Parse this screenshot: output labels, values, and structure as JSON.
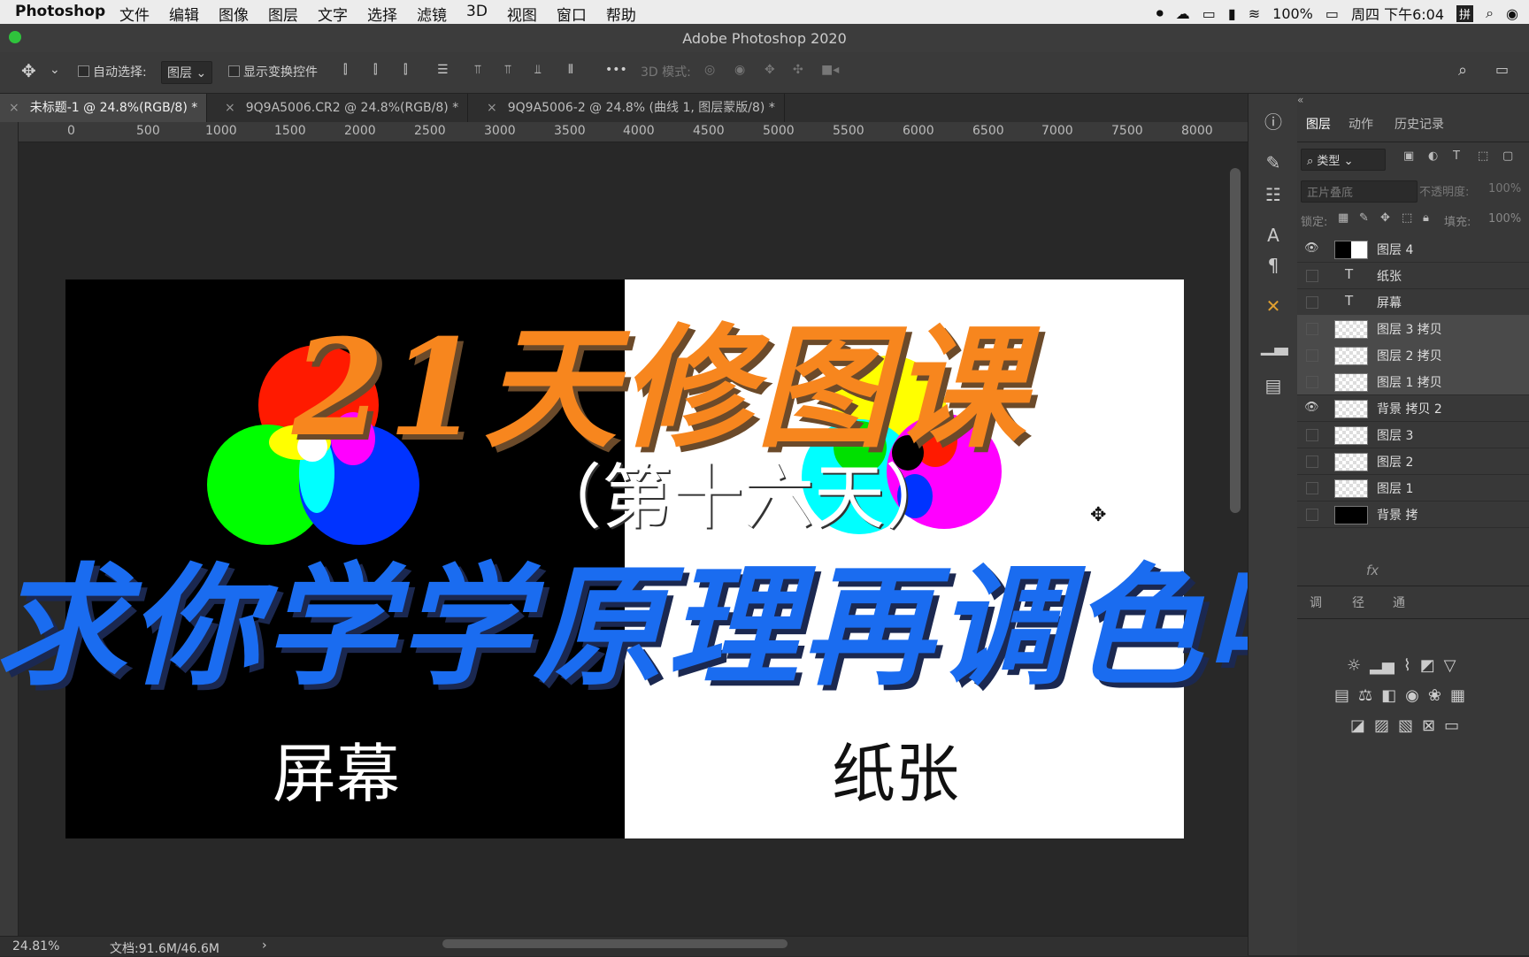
{
  "menubar": {
    "app_name": "Photoshop",
    "menus": [
      "文件",
      "编辑",
      "图像",
      "图层",
      "文字",
      "选择",
      "滤镜",
      "3D",
      "视图",
      "窗口",
      "帮助"
    ],
    "battery": "100%",
    "clock": "周四 下午6:04",
    "input_method": "拼"
  },
  "window": {
    "title": "Adobe Photoshop 2020"
  },
  "options": {
    "auto_select_label": "自动选择:",
    "auto_select_value": "图层",
    "show_transform_label": "显示变换控件",
    "mode_3d_label": "3D 模式:",
    "more": "•••"
  },
  "tabs": [
    {
      "label": "未标题-1 @ 24.8%(RGB/8) *",
      "close": "×"
    },
    {
      "label": "9Q9A5006.CR2 @ 24.8%(RGB/8) *",
      "close": "×"
    },
    {
      "label": "9Q9A5006-2 @ 24.8% (曲线 1, 图层蒙版/8) *",
      "close": "×"
    }
  ],
  "ruler": {
    "ticks": [
      "0",
      "500",
      "1000",
      "1500",
      "2000",
      "2500",
      "3000",
      "3500",
      "4000",
      "4500",
      "5000",
      "5500",
      "6000",
      "6500",
      "7000",
      "7500",
      "8000"
    ]
  },
  "canvas": {
    "left_label": "屏幕",
    "right_label": "纸张",
    "colors": {
      "red": "#ff1a00",
      "green": "#00ff00",
      "blue": "#0000ff",
      "cyan": "#00ffff",
      "magenta": "#ff00ff",
      "yellow": "#ffff00"
    }
  },
  "overlay": {
    "title": "21天修图课",
    "subtitle": "（第十六天）",
    "slogan": "求你学学原理再调色吧",
    "title_color": "#f7861e",
    "slogan_color": "#1a6cf0"
  },
  "status": {
    "zoom": "24.81%",
    "doc": "文档:91.6M/46.6M",
    "arrow": "›"
  },
  "panel": {
    "tabs": [
      "图层",
      "动作",
      "历史记录"
    ],
    "filter_label": "类型",
    "blend_mode": "正片叠底",
    "opacity_label": "不透明度:",
    "opacity_value": "100%",
    "lock_label": "锁定:",
    "fill_label": "填充:",
    "fill_value": "100%",
    "layers": [
      {
        "name": "图层 4",
        "visible": true,
        "type": "image"
      },
      {
        "name": "纸张",
        "visible": false,
        "type": "text"
      },
      {
        "name": "屏幕",
        "visible": false,
        "type": "text"
      },
      {
        "name": "图层 3 拷贝",
        "visible": false,
        "type": "image"
      },
      {
        "name": "图层 2 拷贝",
        "visible": false,
        "type": "image"
      },
      {
        "name": "图层 1 拷贝",
        "visible": false,
        "type": "image"
      },
      {
        "name": "背景 拷贝 2",
        "visible": true,
        "type": "image"
      },
      {
        "name": "图层 3",
        "visible": false,
        "type": "image"
      },
      {
        "name": "图层 2",
        "visible": false,
        "type": "image"
      },
      {
        "name": "图层 1",
        "visible": false,
        "type": "image"
      },
      {
        "name": "背景 拷",
        "visible": false,
        "type": "image"
      }
    ],
    "fx_label": "fx",
    "lower_tabs": [
      "调",
      "径",
      "通"
    ]
  }
}
